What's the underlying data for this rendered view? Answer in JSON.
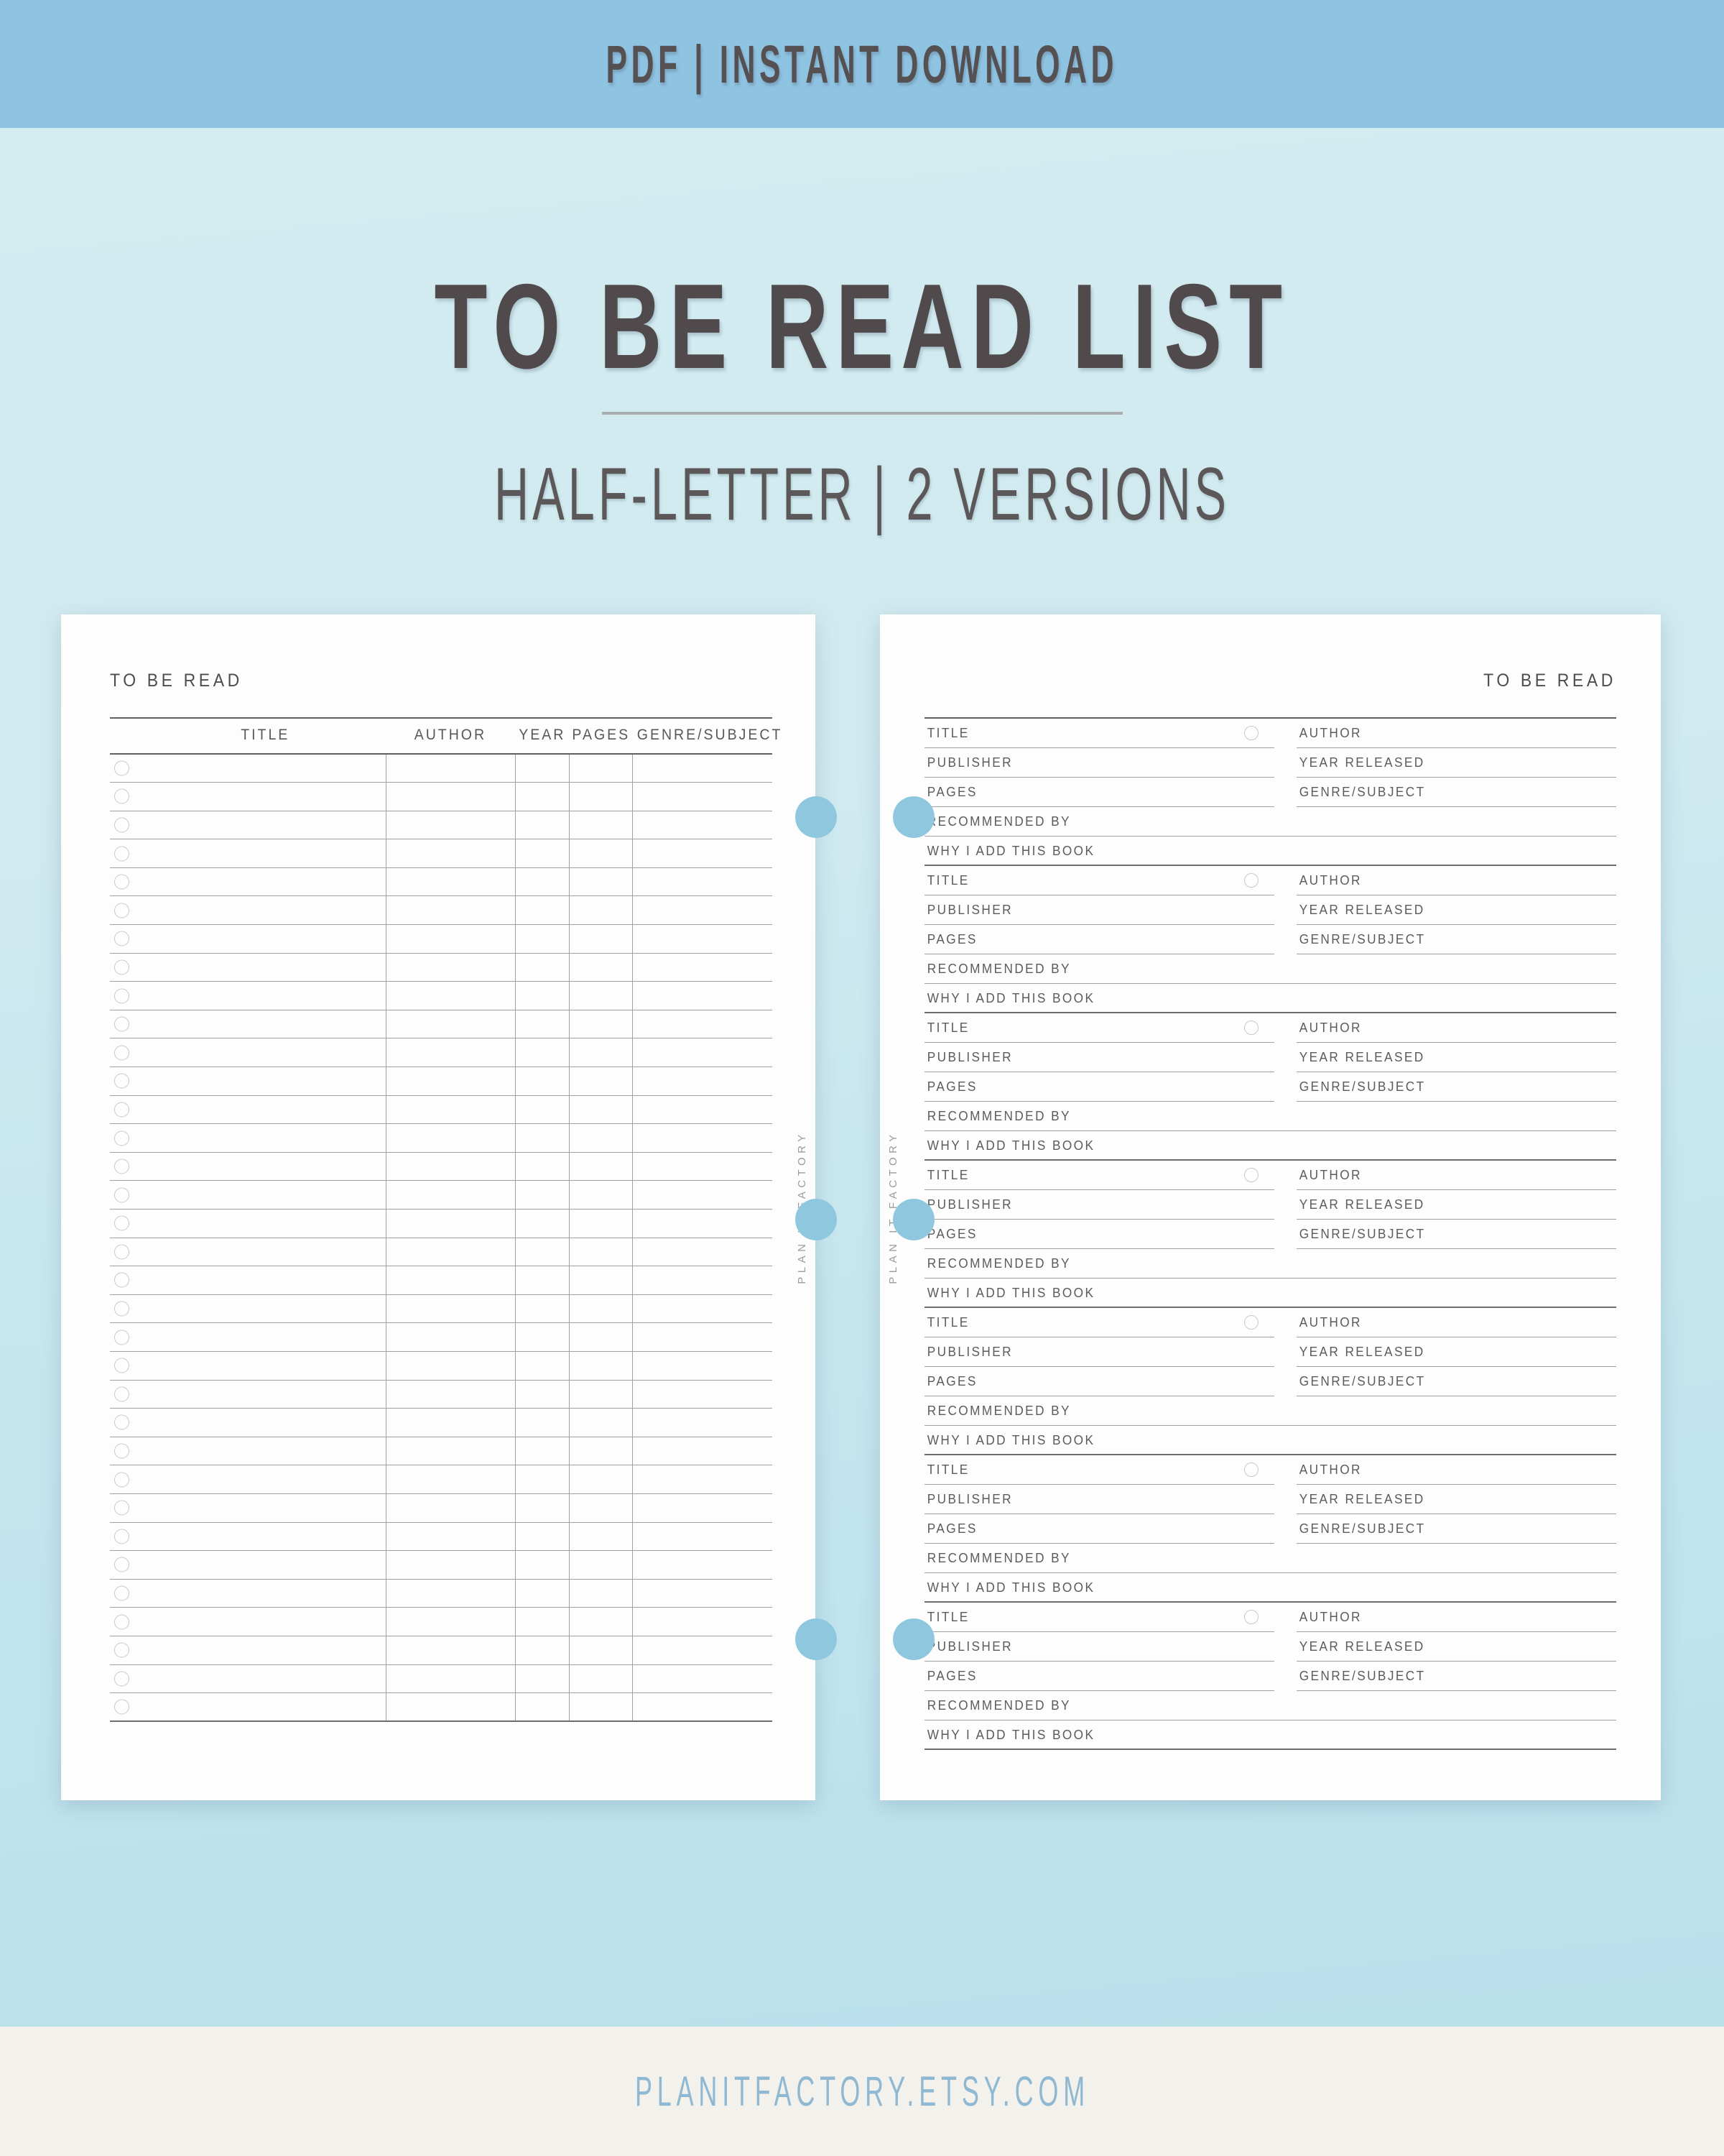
{
  "banner": {
    "text": "PDF | INSTANT DOWNLOAD",
    "bg_color": "#8fc3e2",
    "text_color": "#555052"
  },
  "hero": {
    "title": "TO BE READ LIST",
    "subtitle": "HALF-LETTER | 2 VERSIONS"
  },
  "brand": {
    "vertical_label": "PLAN IT FACTORY"
  },
  "left_page": {
    "heading": "TO BE READ",
    "columns": [
      "",
      "TITLE",
      "AUTHOR",
      "YEAR",
      "PAGES",
      "GENRE/SUBJECT"
    ],
    "row_count": 34
  },
  "right_page": {
    "heading": "TO BE READ",
    "entry_count": 7,
    "entry_fields": {
      "title": "TITLE",
      "author": "AUTHOR",
      "publisher": "PUBLISHER",
      "year_released": "YEAR RELEASED",
      "pages": "PAGES",
      "genre_subject": "GENRE/SUBJECT",
      "recommended_by": "RECOMMENDED BY",
      "why_i_add_this_book": "WHY I ADD THIS BOOK"
    }
  },
  "footer": {
    "text": "PLANITFACTORY.ETSY.COM",
    "bg_color": "#f3f1ec",
    "text_color": "#8fb8d2"
  },
  "colors": {
    "background_top": "#d3ecf0",
    "background_bottom": "#b8dfec",
    "disc_blue": "#8fc8de",
    "ink": "#504a4c"
  }
}
